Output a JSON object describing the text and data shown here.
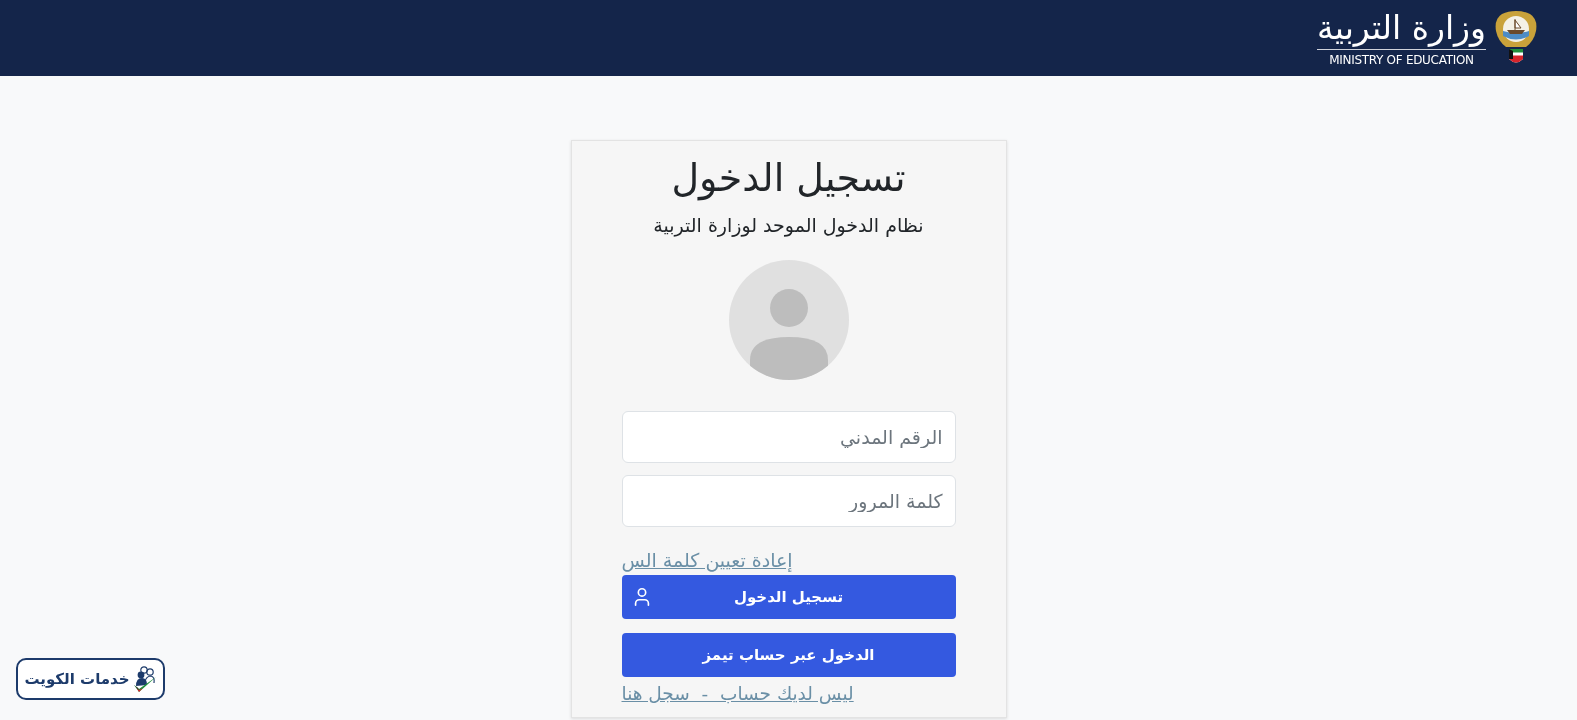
{
  "header": {
    "logo": {
      "arabic": "وزارة التربية",
      "english": "MINISTRY OF EDUCATION"
    }
  },
  "login_card": {
    "title": "تسجيل الدخول",
    "subtitle": "نظام الدخول الموحد لوزارة التربية",
    "fields": [
      {
        "placeholder": "الرقم المدني"
      },
      {
        "placeholder": "كلمة المرور"
      }
    ],
    "reset_link": "إعادة تعيين كلمة الس",
    "buttons": [
      {
        "label": "تسجيل الدخول",
        "kind": "user"
      },
      {
        "label": "الدخول عبر حساب تيمز",
        "kind": "plain"
      }
    ],
    "register_link": "ليس لديك حساب  -  سجل هنا"
  },
  "badge": {
    "label": "خدمات الكويت"
  }
}
